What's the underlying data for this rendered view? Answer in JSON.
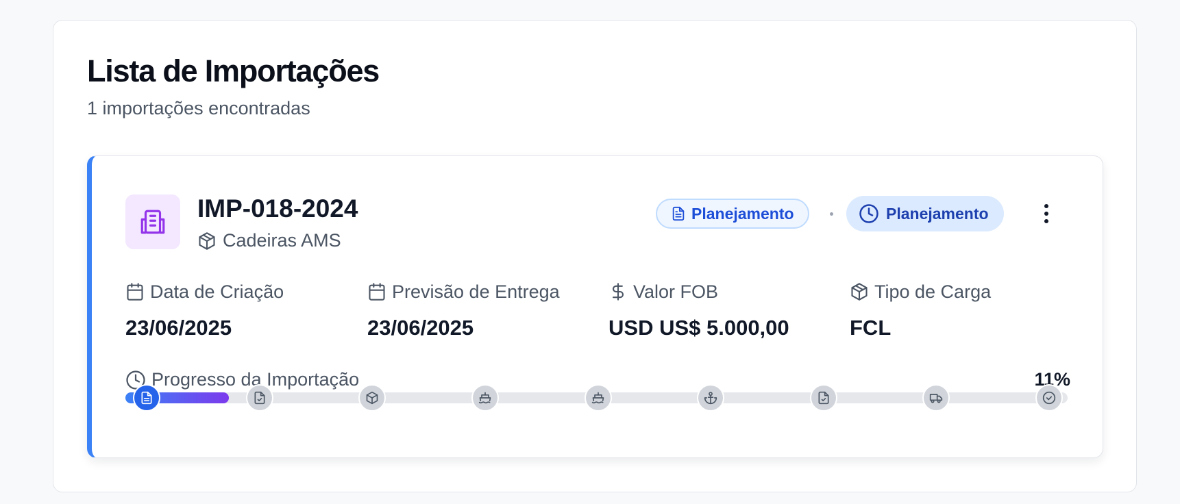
{
  "page": {
    "title": "Lista de Importações",
    "subtitle": "1 importações encontradas"
  },
  "import_card": {
    "code": "IMP-018-2024",
    "product": "Cadeiras AMS",
    "accent_color": "#3b82f6",
    "document_badge": "Planejamento",
    "status_badge": "Planejamento",
    "fields": [
      {
        "label": "Data de Criação",
        "value": "23/06/2025",
        "icon": "calendar-icon"
      },
      {
        "label": "Previsão de Entrega",
        "value": "23/06/2025",
        "icon": "calendar-icon"
      },
      {
        "label": "Valor FOB",
        "value": "USD US$ 5.000,00",
        "icon": "dollar-icon"
      },
      {
        "label": "Tipo de Carga",
        "value": "FCL",
        "icon": "package-icon"
      }
    ],
    "progress": {
      "label": "Progresso da Importação",
      "percent_text": "11%",
      "fraction": 0.11,
      "steps": [
        {
          "icon": "document-icon",
          "active": true
        },
        {
          "icon": "file-check-icon",
          "active": false
        },
        {
          "icon": "package-icon",
          "active": false
        },
        {
          "icon": "ship-icon",
          "active": false
        },
        {
          "icon": "ship-icon",
          "active": false
        },
        {
          "icon": "anchor-icon",
          "active": false
        },
        {
          "icon": "file-check-icon",
          "active": false
        },
        {
          "icon": "truck-icon",
          "active": false
        },
        {
          "icon": "check-circle-icon",
          "active": false
        }
      ]
    }
  }
}
